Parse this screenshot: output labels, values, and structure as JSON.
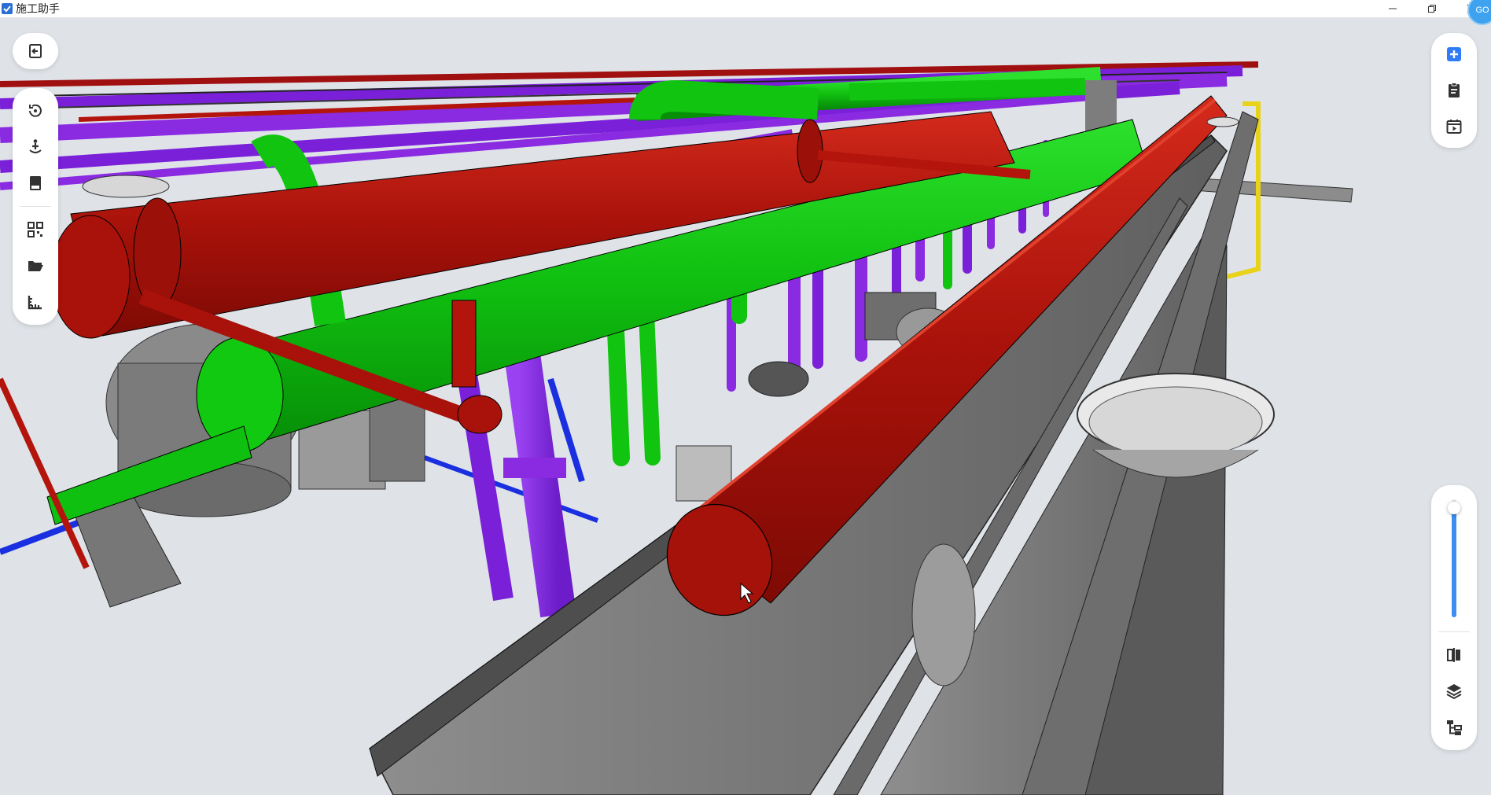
{
  "window": {
    "title": "施工助手",
    "user_initials": "GO"
  },
  "left_toolbar": {
    "items": [
      {
        "icon": "exit-icon"
      },
      {
        "icon": "reset-view-icon"
      },
      {
        "icon": "walk-mode-icon"
      },
      {
        "icon": "book-icon"
      },
      {
        "icon": "qr-code-icon"
      },
      {
        "icon": "folder-open-icon"
      },
      {
        "icon": "measure-icon"
      }
    ]
  },
  "right_toolbar_top": {
    "items": [
      {
        "icon": "add-icon",
        "accent": "#2f7cf6"
      },
      {
        "icon": "clipboard-icon"
      },
      {
        "icon": "schedule-play-icon"
      }
    ]
  },
  "right_toolbar_bottom": {
    "zoom_level": 0.93,
    "items": [
      {
        "icon": "section-cut-icon"
      },
      {
        "icon": "layers-icon"
      },
      {
        "icon": "structure-tree-icon"
      }
    ]
  },
  "colors": {
    "fire_pipe": "#b3150c",
    "water_pipe": "#10c410",
    "drain_pipe": "#8a2be2",
    "cable_tray": "#7a7a7a",
    "background": "#dfe3e8",
    "accent": "#3d8ef0"
  }
}
